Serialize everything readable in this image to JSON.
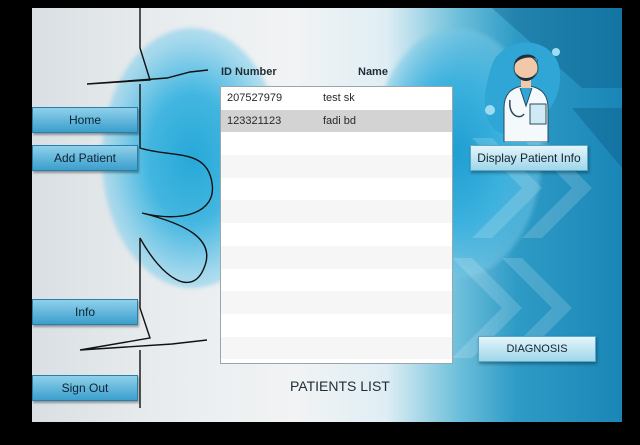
{
  "sidebar": {
    "home": "Home",
    "add_patient": "Add Patient",
    "info": "Info",
    "sign_out": "Sign Out"
  },
  "list": {
    "columns": [
      "ID Number",
      "Name"
    ],
    "rows": [
      {
        "id": "207527979",
        "name": "test sk"
      },
      {
        "id": "123321123",
        "name": "fadi bd"
      }
    ],
    "selected_row": 1,
    "title": "PATIENTS LIST"
  },
  "actions": {
    "display_info": "Display Patient Info",
    "diagnosis": "DIAGNOSIS"
  },
  "icons": {
    "doctor": "doctor-illustration-icon",
    "heartbeat": "heartbeat-line-icon"
  },
  "colors": {
    "button_blue": "#3a9fcd",
    "accent_blue": "#1a86b7",
    "selected_row": "#d3d3d3"
  }
}
